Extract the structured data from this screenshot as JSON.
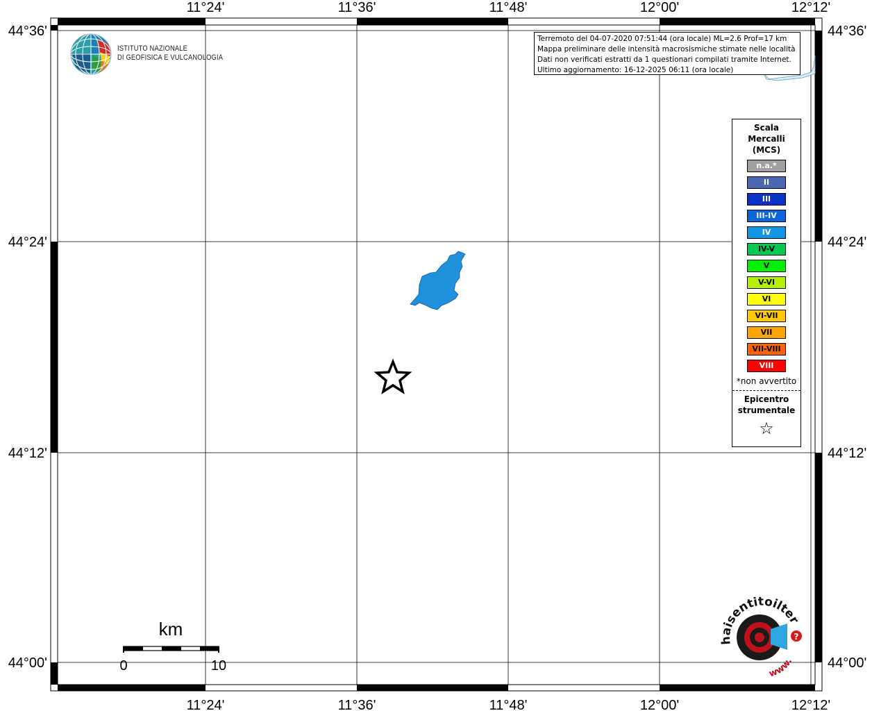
{
  "map": {
    "lon_ticks_top": [
      "11°24'",
      "11°36'",
      "11°48'",
      "12°00'",
      "12°12'"
    ],
    "lon_ticks_bottom": [
      "11°24'",
      "11°36'",
      "11°48'",
      "12°00'",
      "12°12'"
    ],
    "lat_ticks_left": [
      "44°36'",
      "44°24'",
      "44°12'",
      "44°00'"
    ],
    "lat_ticks_right": [
      "44°36'",
      "44°24'",
      "44°12'",
      "44°00'"
    ],
    "municipality_intensity": "IV",
    "municipality_color": "#1e90dc",
    "epicenter_symbol": "star"
  },
  "info": {
    "line1": "Terremoto del 04-07-2020 07:51:44 (ora locale) ML=2.6 Prof=17 km",
    "line2": "Mappa preliminare delle intensità macrosismiche stimate nelle località",
    "line3": "Dati non verificati estratti da 1 questionari compilati tramite Internet.",
    "line4": "Ultimo aggiornamento: 16-12-2025 06:11 (ora locale)"
  },
  "legend": {
    "title": "Scala\nMercalli\n(MCS)",
    "items": [
      {
        "label": "n.a.*",
        "color": "#a0a0a0",
        "text_color": "#ffffff"
      },
      {
        "label": "II",
        "color": "#4a67b4",
        "text_color": "#ffffff"
      },
      {
        "label": "III",
        "color": "#0a32c8",
        "text_color": "#ffffff"
      },
      {
        "label": "III-IV",
        "color": "#0a64dc",
        "text_color": "#ffffff"
      },
      {
        "label": "IV",
        "color": "#1496e6",
        "text_color": "#ffffff"
      },
      {
        "label": "IV-V",
        "color": "#00c850",
        "text_color": "#000000"
      },
      {
        "label": "V",
        "color": "#00f000",
        "text_color": "#000000"
      },
      {
        "label": "V-VI",
        "color": "#b4f000",
        "text_color": "#000000"
      },
      {
        "label": "VI",
        "color": "#ffff00",
        "text_color": "#000000"
      },
      {
        "label": "VI-VII",
        "color": "#ffc800",
        "text_color": "#000000"
      },
      {
        "label": "VII",
        "color": "#ffa500",
        "text_color": "#000000"
      },
      {
        "label": "VII-VIII",
        "color": "#ff6400",
        "text_color": "#000000"
      },
      {
        "label": "VIII",
        "color": "#ff0000",
        "text_color": "#ffffff"
      }
    ],
    "note": "*non avvertito",
    "epicenter_label": "Epicentro\nstrumentale",
    "epicenter_glyph": "☆"
  },
  "scale_bar": {
    "unit": "km",
    "start_label": "0",
    "end_label": "10"
  },
  "ingv": {
    "line1": "ISTITUTO NAZIONALE",
    "line2": "DI GEOFISICA E VULCANOLOGIA"
  },
  "hst_logo": {
    "text": "haisentitoilterremoto.it",
    "url_text": "www."
  }
}
